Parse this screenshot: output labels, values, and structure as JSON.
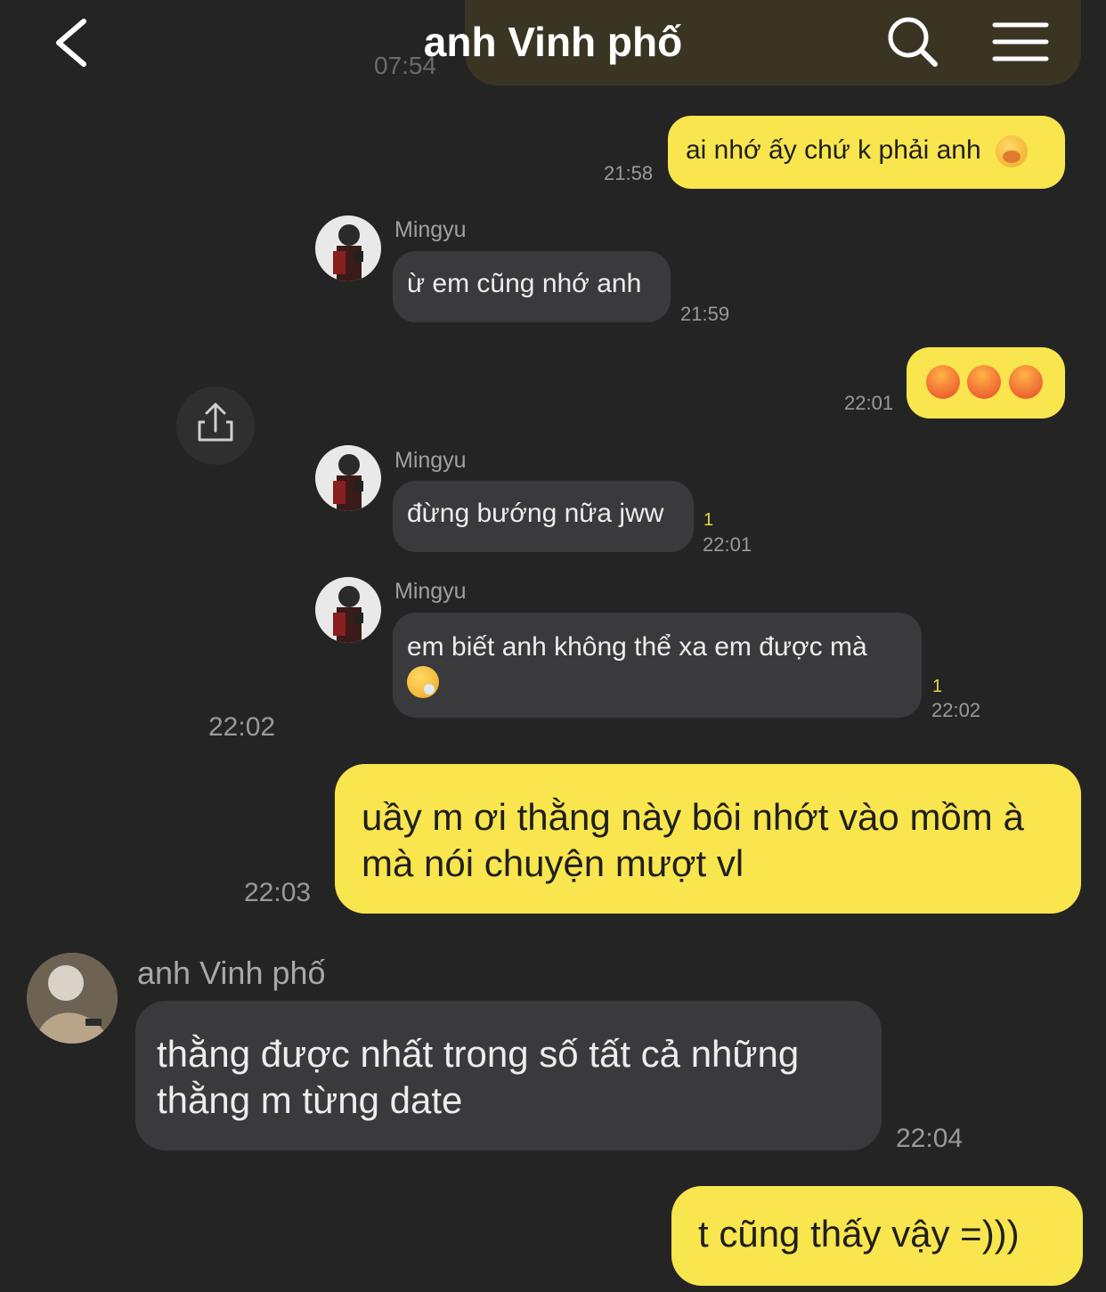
{
  "header": {
    "title": "anh Vinh phố"
  },
  "top_partial": {
    "time": "07:54"
  },
  "messages": [
    {
      "text": "ai nhớ ấy chứ k phải anh",
      "time": "21:58"
    },
    {
      "sender": "Mingyu",
      "text": "ừ em cũng nhớ anh",
      "time": "21:59"
    },
    {
      "time": "22:01"
    },
    {
      "sender": "Mingyu",
      "text": "đừng bướng nữa jww",
      "unread": "1",
      "time": "22:01"
    },
    {
      "sender": "Mingyu",
      "text": "em biết anh không thể xa em được mà",
      "unread": "1",
      "time": "22:02"
    },
    {
      "time": "22:02"
    },
    {
      "text": "uầy m ơi thằng này bôi nhớt vào mồm à mà nói chuyện mượt vl",
      "time": "22:03"
    },
    {
      "sender": "anh Vinh phố",
      "text": "thằng được nhất trong số tất cả những thằng m từng date",
      "time": "22:04"
    },
    {
      "text": "t cũng thấy vậy =)))"
    }
  ],
  "colors": {
    "background": "#242424",
    "my_bubble": "#F9E54D",
    "their_bubble": "#3A3A3C"
  }
}
